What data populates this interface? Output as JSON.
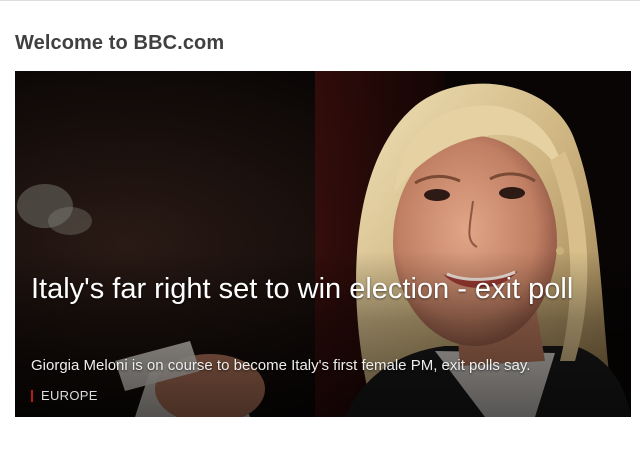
{
  "page": {
    "welcome_title": "Welcome to BBC.com"
  },
  "hero": {
    "image_subject": "photo of a smiling blonde woman in a dark jacket",
    "headline": "Italy's far right set to win election - exit poll",
    "summary": "Giorgia Meloni is on course to become Italy's first female PM, exit polls say.",
    "section_label": "EUROPE",
    "section_accent_color": "#bb1919"
  }
}
